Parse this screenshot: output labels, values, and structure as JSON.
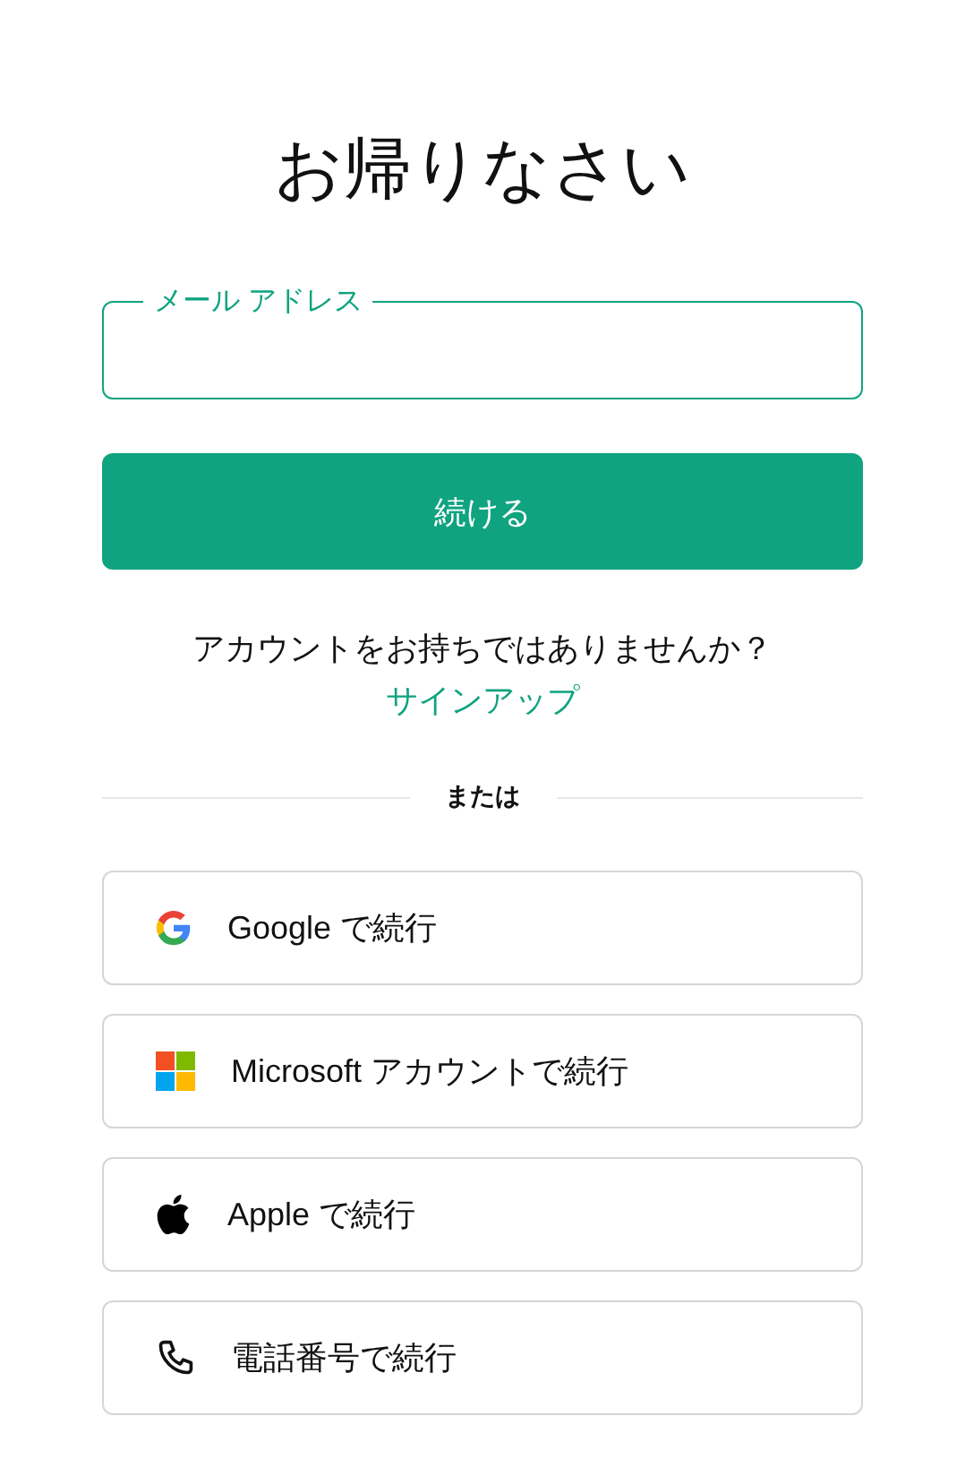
{
  "title": "お帰りなさい",
  "email_field": {
    "label": "メール アドレス",
    "focused": true
  },
  "continue_button": "続ける",
  "signup_prompt": {
    "text": "アカウントをお持ちではありませんか？",
    "link": "サインアップ"
  },
  "divider": "または",
  "providers": [
    {
      "kind": "google",
      "label": "Google で続行"
    },
    {
      "kind": "microsoft",
      "label": "Microsoft アカウントで続行"
    },
    {
      "kind": "apple",
      "label": "Apple で続行"
    },
    {
      "kind": "phone",
      "label": "電話番号で続行"
    }
  ]
}
